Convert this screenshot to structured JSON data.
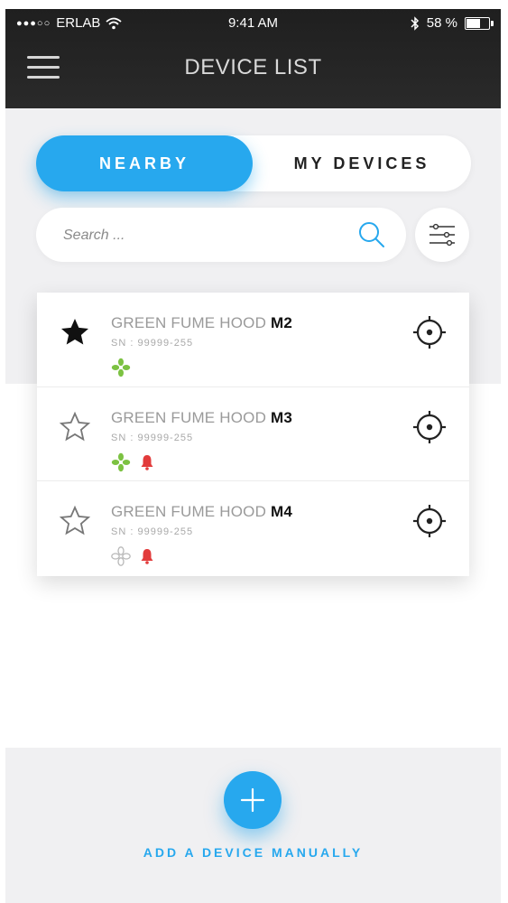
{
  "status_bar": {
    "carrier": "ERLAB",
    "time": "9:41 AM",
    "battery": "58 %",
    "battery_level": 0.58
  },
  "header": {
    "title": "DEVICE LIST",
    "menu_icon": "hamburger-icon"
  },
  "tabs": {
    "nearby": "NEARBY",
    "my_devices": "MY DEVICES",
    "active": "nearby"
  },
  "search": {
    "placeholder": "Search ...",
    "value": "",
    "icon": "search-icon"
  },
  "filter": {
    "icon": "filter-sliders-icon"
  },
  "devices": [
    {
      "name": "GREEN FUME HOOD",
      "model": "M2",
      "sn_label": "SN :",
      "sn": "99999-255",
      "favorite": true,
      "fan_active": true,
      "alarm": false
    },
    {
      "name": "GREEN FUME HOOD",
      "model": "M3",
      "sn_label": "SN :",
      "sn": "99999-255",
      "favorite": false,
      "fan_active": true,
      "alarm": true
    },
    {
      "name": "GREEN FUME HOOD",
      "model": "M4",
      "sn_label": "SN :",
      "sn": "99999-255",
      "favorite": false,
      "fan_active": false,
      "alarm": true
    }
  ],
  "footer": {
    "add_label": "ADD A DEVICE MANUALLY"
  },
  "colors": {
    "accent": "#27a8ee",
    "fan_green": "#7cc242",
    "alarm_red": "#e23b3b",
    "header_bg": "#222222"
  }
}
